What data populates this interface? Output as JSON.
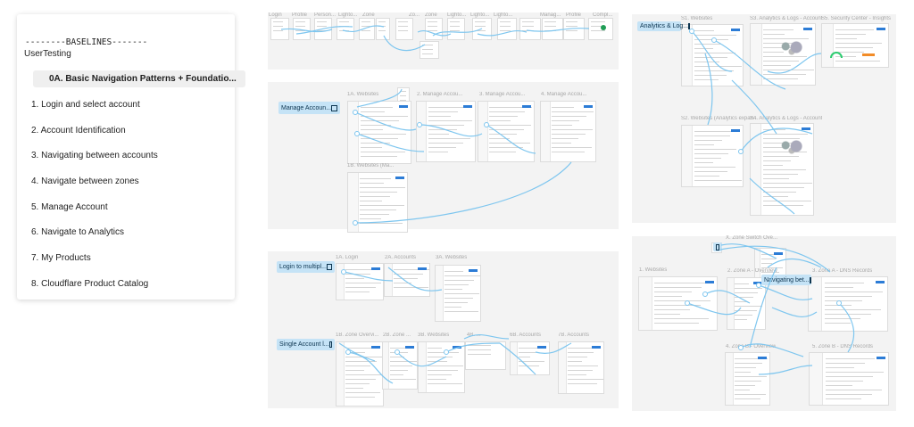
{
  "panel": {
    "items": [
      {
        "label": "--------BASELINES-------",
        "kind": "title"
      },
      {
        "label": "UserTesting",
        "kind": "group"
      },
      {
        "label": "0A. Basic Navigation Patterns + Foundatio...",
        "kind": "selected"
      },
      {
        "label": "1. Login and select account",
        "kind": "page"
      },
      {
        "label": "2. Account Identification",
        "kind": "page"
      },
      {
        "label": "3. Navigating between accounts",
        "kind": "page"
      },
      {
        "label": "4. Navigate between zones",
        "kind": "page"
      },
      {
        "label": "5. Manage Account",
        "kind": "page"
      },
      {
        "label": "6. Navigate to Analytics",
        "kind": "page"
      },
      {
        "label": "7. My Products",
        "kind": "page"
      },
      {
        "label": "8. Cloudflare Product Catalog",
        "kind": "page"
      }
    ]
  },
  "canvas": {
    "wire_color": "#7ec6ef",
    "section_color": "#f3f3f3",
    "section_labels": [
      {
        "text": "Manage Accoun..."
      },
      {
        "text": "Login to multipl..."
      },
      {
        "text": "Single Account l..."
      },
      {
        "text": "Analytics & Log..."
      },
      {
        "text": "Navigating bet..."
      }
    ],
    "frame_labels": [
      {
        "text": "Login"
      },
      {
        "text": "Profile"
      },
      {
        "text": "Person..."
      },
      {
        "text": "Lighto..."
      },
      {
        "text": "Zone"
      },
      {
        "text": "Zo..."
      },
      {
        "text": "Zone"
      },
      {
        "text": "Lighto..."
      },
      {
        "text": "Lighto..."
      },
      {
        "text": "Lighto..."
      },
      {
        "text": "Manag..."
      },
      {
        "text": "Profile"
      },
      {
        "text": "Compl..."
      },
      {
        "text": "1A. Websites"
      },
      {
        "text": "2. Manage Accou..."
      },
      {
        "text": "3. Manage Accou..."
      },
      {
        "text": "4. Manage Accou..."
      },
      {
        "text": "1B. Websites (Ma..."
      },
      {
        "text": "1A. Login"
      },
      {
        "text": "2A. Accounts"
      },
      {
        "text": "3A. Websites"
      },
      {
        "text": "1B. Zone Overvi..."
      },
      {
        "text": "2B. Zone ..."
      },
      {
        "text": "3B. Websites"
      },
      {
        "text": "4B. ..."
      },
      {
        "text": "6B. Accounts"
      },
      {
        "text": "7B. Accounts"
      },
      {
        "text": "S1. Websites"
      },
      {
        "text": "S3. Analytics & Logs - Account"
      },
      {
        "text": "S5. Security Center - Insights"
      },
      {
        "text": "S2. Websites (Analytics expan..."
      },
      {
        "text": "S4. Analytics & Logs - Account"
      },
      {
        "text": "X. Zone Switch Ove..."
      },
      {
        "text": "1. Websites"
      },
      {
        "text": "2. Zone A - Overview"
      },
      {
        "text": "3. Zone A - DNS Records"
      },
      {
        "text": "4. Zone B - Overview"
      },
      {
        "text": "5. Zone B - DNS Records"
      }
    ]
  }
}
